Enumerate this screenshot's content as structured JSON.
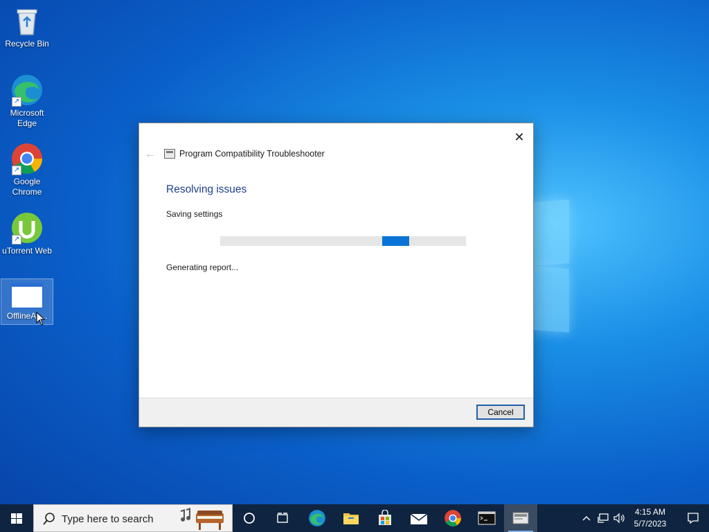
{
  "desktop": {
    "icons": [
      {
        "label": "Recycle Bin"
      },
      {
        "label": "Microsoft Edge"
      },
      {
        "label": "Google Chrome"
      },
      {
        "label": "uTorrent Web"
      },
      {
        "label": "OfflineAc..."
      }
    ]
  },
  "dialog": {
    "title": "Program Compatibility Troubleshooter",
    "heading": "Resolving issues",
    "status_primary": "Saving settings",
    "status_secondary": "Generating report...",
    "close_symbol": "✕",
    "back_symbol": "←",
    "cancel_label": "Cancel",
    "progress_indeterminate": true,
    "accent_color": "#0a74d6",
    "heading_color": "#1e3f8a"
  },
  "taskbar": {
    "search_placeholder": "Type here to search",
    "clock_time": "4:15 AM",
    "clock_date": "5/7/2023"
  }
}
